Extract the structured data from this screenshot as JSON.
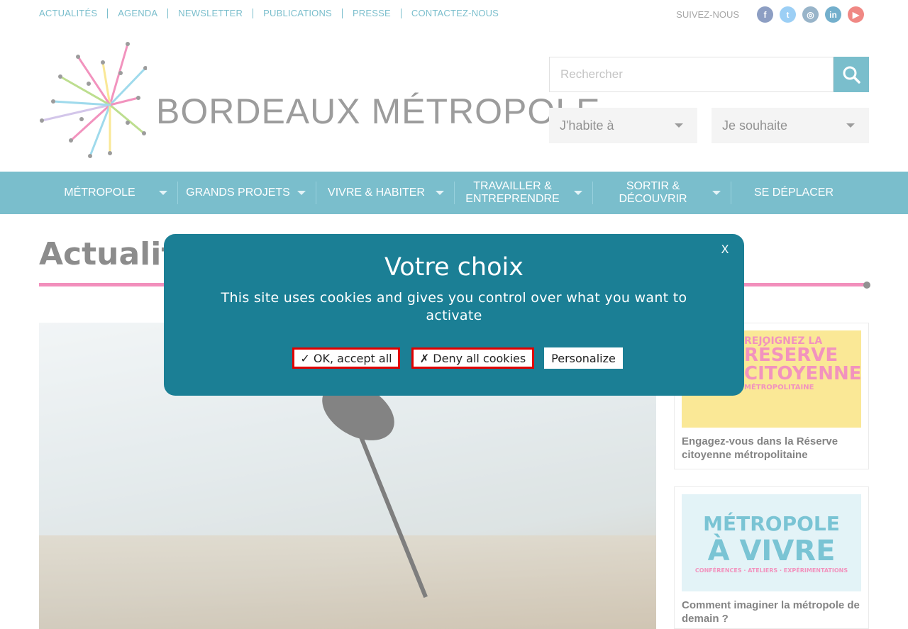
{
  "topbar": {
    "links": [
      "ACTUALITÉS",
      "AGENDA",
      "NEWSLETTER",
      "PUBLICATIONS",
      "PRESSE",
      "CONTACTEZ-NOUS"
    ],
    "follow_label": "SUIVEZ-NOUS",
    "social_icons": [
      "facebook-icon",
      "twitter-icon",
      "instagram-icon",
      "linkedin-icon",
      "youtube-icon"
    ]
  },
  "header": {
    "logo_text": "BORDEAUX MÉTROPOLE",
    "search_placeholder": "Rechercher",
    "dropdown_1": "J'habite à",
    "dropdown_2": "Je souhaite"
  },
  "nav": {
    "items": [
      {
        "label": "MÉTROPOLE",
        "has_caret": true
      },
      {
        "label": "GRANDS PROJETS",
        "has_caret": true
      },
      {
        "label": "VIVRE & HABITER",
        "has_caret": true
      },
      {
        "label": "TRAVAILLER & ENTREPRENDRE",
        "has_caret": true
      },
      {
        "label": "SORTIR & DÉCOUVRIR",
        "has_caret": true
      },
      {
        "label": "SE DÉPLACER",
        "has_caret": false
      }
    ]
  },
  "page": {
    "title": "Actualité"
  },
  "sidebar": {
    "cards": [
      {
        "image_text_1": "REJOIGNEZ LA",
        "image_text_2": "RÉSERVE CITOYENNE",
        "image_text_3": "MÉTROPOLITAINE",
        "caption": "Engagez-vous dans la Réserve citoyenne métropolitaine"
      },
      {
        "image_text_1": "MÉTROPOLE",
        "image_text_2": "À VIVRE",
        "image_text_3": "CONFÉRENCES · ATELIERS · EXPÉRIMENTATIONS",
        "caption": "Comment imaginer la métropole de demain ?"
      }
    ]
  },
  "cookie_modal": {
    "close_label": "X",
    "title": "Votre choix",
    "text": "This site uses cookies and gives you control over what you want to activate",
    "accept_label": "✓ OK, accept all",
    "deny_label": "✗ Deny all cookies",
    "personalize_label": "Personalize"
  },
  "colors": {
    "brand_teal": "#1a8fa8",
    "modal_bg": "#1b7f95",
    "accent_pink": "#e83e8c",
    "highlight_red": "#e00000"
  }
}
